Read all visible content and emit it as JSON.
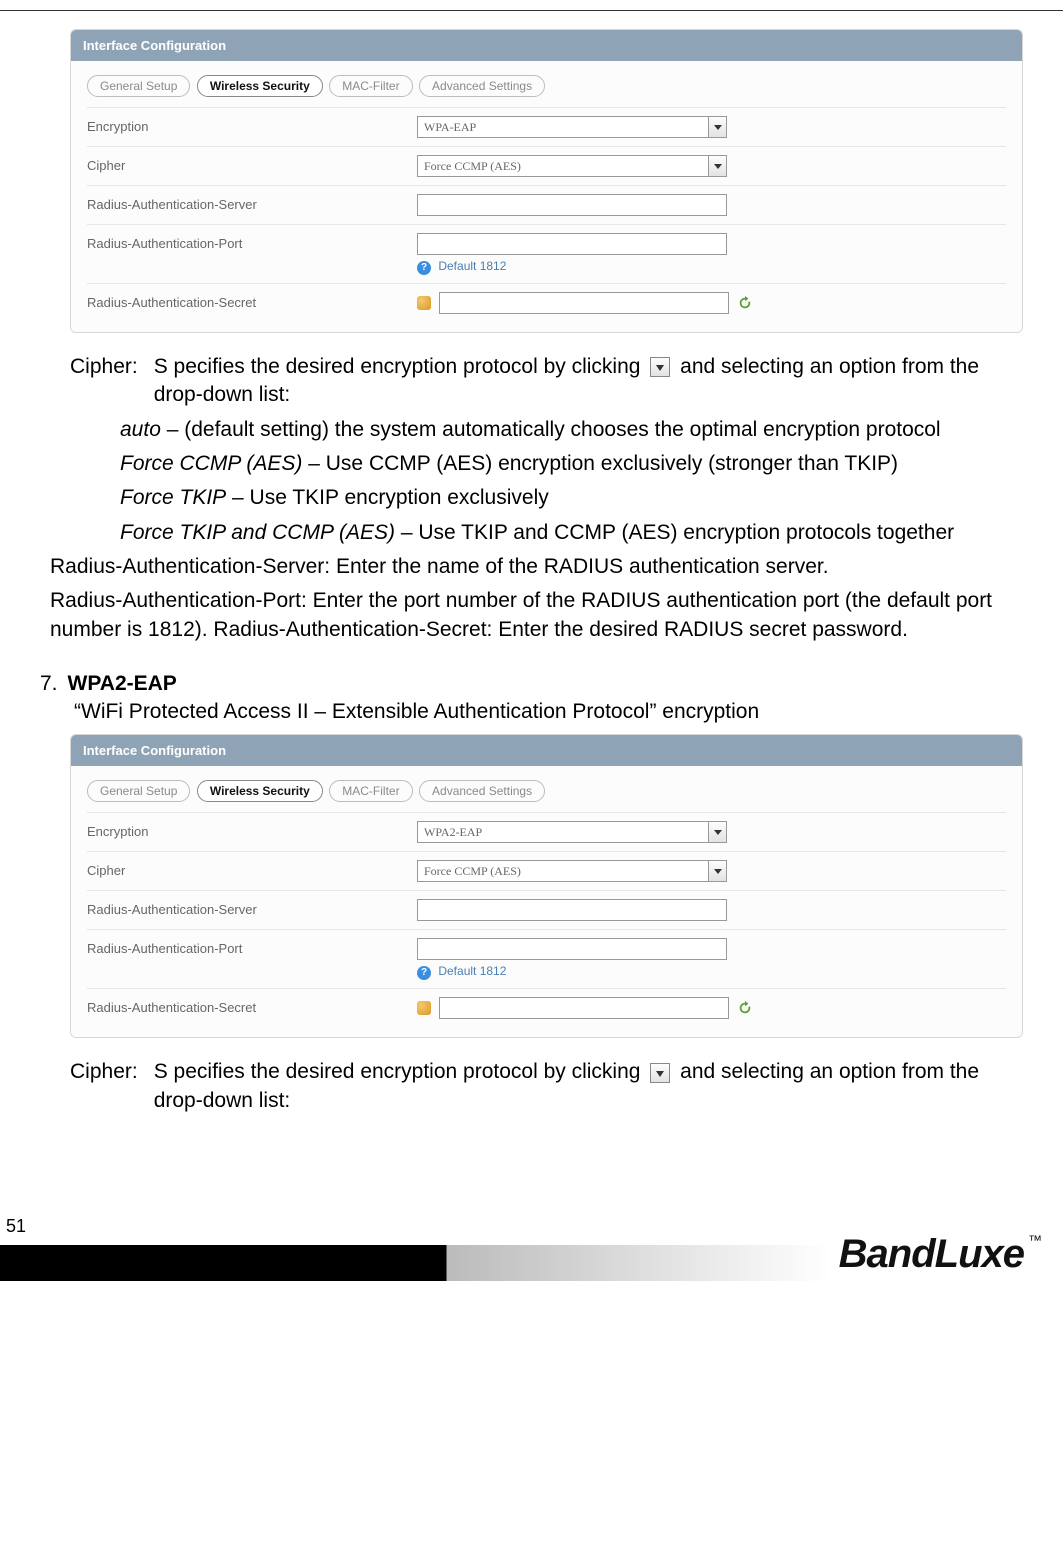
{
  "panel1": {
    "title": "Interface Configuration",
    "tabs": [
      "General Setup",
      "Wireless Security",
      "MAC-Filter",
      "Advanced Settings"
    ],
    "active_tab_index": 1,
    "rows": {
      "encryption": {
        "label": "Encryption",
        "value": "WPA-EAP"
      },
      "cipher": {
        "label": "Cipher",
        "value": "Force CCMP (AES)"
      },
      "server": {
        "label": "Radius-Authentication-Server",
        "value": ""
      },
      "port": {
        "label": "Radius-Authentication-Port",
        "value": "",
        "hint": "Default 1812"
      },
      "secret": {
        "label": "Radius-Authentication-Secret",
        "value": ""
      }
    }
  },
  "panel2": {
    "title": "Interface Configuration",
    "tabs": [
      "General Setup",
      "Wireless Security",
      "MAC-Filter",
      "Advanced Settings"
    ],
    "active_tab_index": 1,
    "rows": {
      "encryption": {
        "label": "Encryption",
        "value": "WPA2-EAP"
      },
      "cipher": {
        "label": "Cipher",
        "value": "Force CCMP (AES)"
      },
      "server": {
        "label": "Radius-Authentication-Server",
        "value": ""
      },
      "port": {
        "label": "Radius-Authentication-Port",
        "value": "",
        "hint": "Default 1812"
      },
      "secret": {
        "label": "Radius-Authentication-Secret",
        "value": ""
      }
    }
  },
  "doc": {
    "cipher_term": "Cipher:",
    "cipher_lead_a": "S pecifies the desired encryption protocol by clicking",
    "cipher_lead_b": "and selecting an option from the drop-down list:",
    "opt_auto_term": "auto",
    "opt_auto_body": " – (default setting) the system automatically chooses the optimal encryption protocol",
    "opt_ccmp_term": "Force CCMP (AES)",
    "opt_ccmp_body": " – Use CCMP (AES) encryption exclusively (stronger than TKIP)",
    "opt_tkip_term": "Force TKIP",
    "opt_tkip_body": " – Use TKIP encryption exclusively",
    "opt_both_term": "Force TKIP and CCMP (AES)",
    "opt_both_body": " – Use TKIP and CCMP (AES) encryption protocols together",
    "ras_server": "Radius-Authentication-Server:    Enter the name of the RADIUS authentication server.",
    "ras_port": "Radius-Authentication-Port:    Enter the port number of the RADIUS authentication port (the default port number is 1812). Radius-Authentication-Secret:    Enter the desired RADIUS secret password.",
    "sec_num": "7.",
    "sec_title": "WPA2-EAP",
    "sec_desc": "“WiFi Protected Access II – Extensible Authentication Protocol” encryption",
    "cipher2_lead_a": "S pecifies the desired encryption protocol by clicking",
    "cipher2_lead_b": "and selecting an option from the drop-down list:"
  },
  "footer": {
    "page": "51",
    "brand": "BandLuxe",
    "tm": "™"
  }
}
